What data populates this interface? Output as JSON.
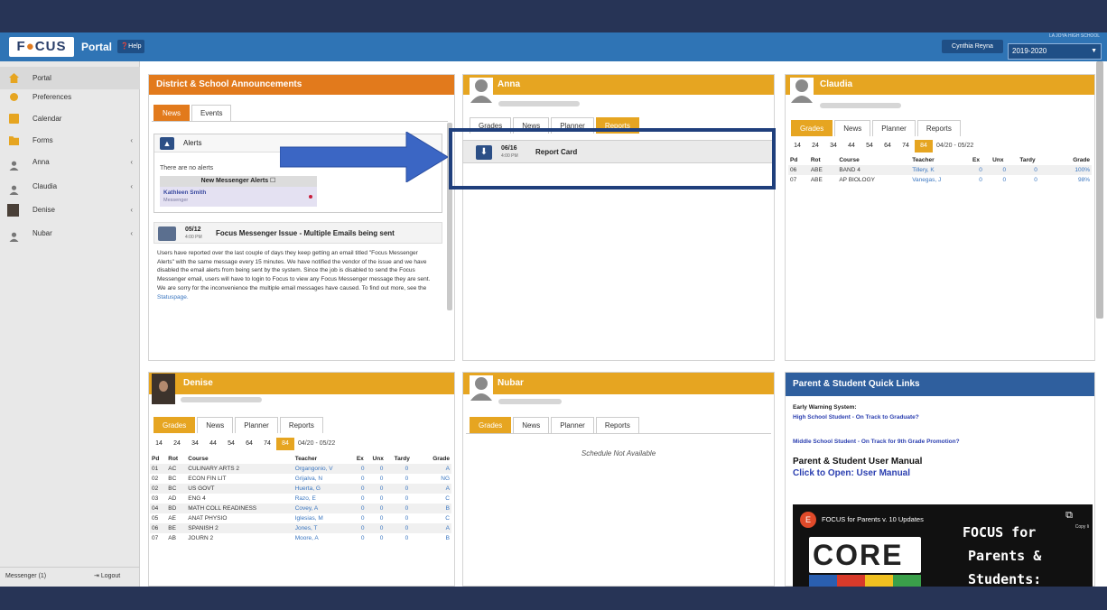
{
  "header": {
    "logo_text": "FOCUS",
    "portal_label": "Portal",
    "help_label": "Help",
    "user_name": "Cynthia Reyna",
    "school_name": "LA JOYA HIGH SCHOOL",
    "year": "2019-2020"
  },
  "sidebar": {
    "items": [
      {
        "label": "Portal",
        "icon": "house-icon"
      },
      {
        "label": "Preferences",
        "icon": "gear-icon"
      },
      {
        "label": "Calendar",
        "icon": "calendar-icon"
      },
      {
        "label": "Forms",
        "icon": "folder-icon"
      },
      {
        "label": "Anna",
        "icon": "person-icon"
      },
      {
        "label": "Claudia",
        "icon": "person-icon"
      },
      {
        "label": "Denise",
        "icon": "photo-avatar"
      },
      {
        "label": "Nubar",
        "icon": "person-icon"
      }
    ],
    "messenger_label": "Messenger (1)",
    "logout_label": "Logout"
  },
  "announcements": {
    "title": "District & School Announcements",
    "tabs": [
      "News",
      "Events"
    ],
    "alerts_label": "Alerts",
    "no_alerts": "There are no alerts",
    "messenger_alerts": "New Messenger Alerts",
    "sender": "Kathleen Smith",
    "sender_sub": "Messenger",
    "news_date": "05/12",
    "news_time": "4:00 PM",
    "news_title": "Focus Messenger Issue - Multiple Emails being sent",
    "news_body": "Users have reported over the last couple of days they keep getting an email titled \"Focus Messenger Alerts\" with the same message every 15 minutes. We have notified the vendor of the issue and we have disabled the email alerts from being sent by the system. Since the job is disabled to send the Focus Messenger email, users will have to login to Focus to view any Focus Messenger message they are sent. We are sorry for the inconvenience the multiple email messages have caused. To find out more, see the",
    "news_link": "Statuspage."
  },
  "anna": {
    "name": "Anna",
    "tabs": [
      "Grades",
      "News",
      "Planner",
      "Reports"
    ],
    "report_date": "06/16",
    "report_time": "4:00 PM",
    "report_label": "Report Card"
  },
  "claudia": {
    "name": "Claudia",
    "tabs": [
      "Grades",
      "News",
      "Planner",
      "Reports"
    ],
    "quarters": [
      "14",
      "24",
      "34",
      "44",
      "54",
      "64",
      "74",
      "84"
    ],
    "active_quarter": "84",
    "range": "04/20 - 05/22",
    "columns": [
      "Pd",
      "Rot",
      "Course",
      "Teacher",
      "Ex",
      "Unx",
      "Tardy",
      "Grade"
    ],
    "rows": [
      [
        "06",
        "ABE",
        "BAND 4",
        "Tillery, K",
        "0",
        "0",
        "0",
        "100%"
      ],
      [
        "07",
        "ABE",
        "AP BIOLOGY",
        "Vanegas, J",
        "0",
        "0",
        "0",
        "98%"
      ]
    ]
  },
  "denise": {
    "name": "Denise",
    "tabs": [
      "Grades",
      "News",
      "Planner",
      "Reports"
    ],
    "quarters": [
      "14",
      "24",
      "34",
      "44",
      "54",
      "64",
      "74",
      "84"
    ],
    "active_quarter": "84",
    "range": "04/20 - 05/22",
    "columns": [
      "Pd",
      "Rot",
      "Course",
      "Teacher",
      "Ex",
      "Unx",
      "Tardy",
      "Grade"
    ],
    "rows": [
      [
        "01",
        "AC",
        "CULINARY ARTS 2",
        "Organgonio, V",
        "0",
        "0",
        "0",
        "A"
      ],
      [
        "02",
        "BC",
        "ECON FIN LIT",
        "Grijalva, N",
        "0",
        "0",
        "0",
        "NG"
      ],
      [
        "02",
        "BC",
        "US GOVT",
        "Huerta, G",
        "0",
        "0",
        "0",
        "A"
      ],
      [
        "03",
        "AD",
        "ENG 4",
        "Razo, E",
        "0",
        "0",
        "0",
        "C"
      ],
      [
        "04",
        "BD",
        "MATH COLL READINESS",
        "Covey, A",
        "0",
        "0",
        "0",
        "B"
      ],
      [
        "05",
        "AE",
        "ANAT PHYSIO",
        "Iglesias, M",
        "0",
        "0",
        "0",
        "C"
      ],
      [
        "06",
        "BE",
        "SPANISH 2",
        "Jones, T",
        "0",
        "0",
        "0",
        "A"
      ],
      [
        "07",
        "AB",
        "JOURN 2",
        "Moore, A",
        "0",
        "0",
        "0",
        "B"
      ]
    ]
  },
  "nubar": {
    "name": "Nubar",
    "tabs": [
      "Grades",
      "News",
      "Planner",
      "Reports"
    ],
    "schedule_msg": "Schedule Not Available"
  },
  "quick_links": {
    "title": "Parent & Student Quick Links",
    "early_warning": "Early Warning System:",
    "hs_link": "High School Student - On Track to Graduate?",
    "ms_link": "Middle School Student - On Track for 9th Grade Promotion?",
    "manual_title": "Parent & Student User Manual",
    "manual_link": "Click to Open: User Manual",
    "video_title": "FOCUS for Parents v. 10 Updates",
    "video_channel": "E",
    "copy_label": "Copy li",
    "video_logo": "CORE",
    "video_caption_1": "FOCUS for",
    "video_caption_2": "Parents &",
    "video_caption_3": "Students:"
  },
  "colors": {
    "header_blue": "#2f74b5",
    "gold": "#e6a521",
    "orange": "#e27a1c",
    "navy_highlight": "#1f3f7c",
    "arrow_blue": "#3b66c4"
  }
}
